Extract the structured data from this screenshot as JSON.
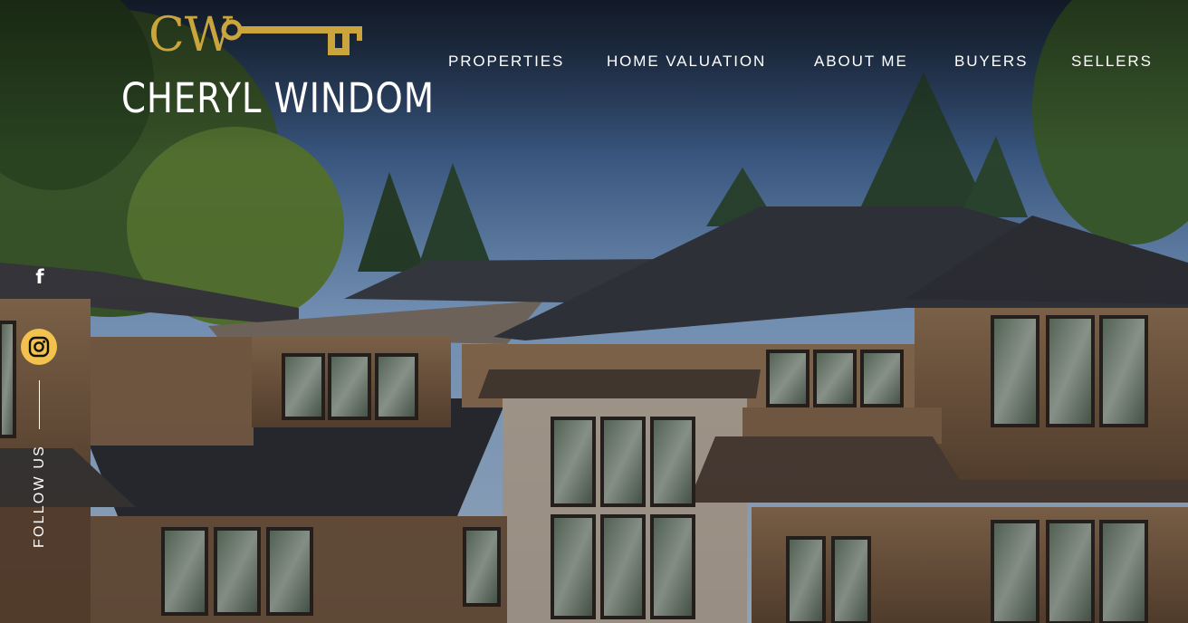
{
  "brand": {
    "monogram": "CW",
    "name": "CHERYL WINDOM",
    "accent_color": "#c9a53c"
  },
  "nav": {
    "items": [
      "PROPERTIES",
      "HOME VALUATION",
      "ABOUT ME",
      "BUYERS",
      "SELLERS"
    ]
  },
  "social": {
    "facebook_icon": "facebook-icon",
    "instagram_icon": "instagram-icon",
    "instagram_bg": "#f2c14e",
    "follow_label": "FOLLOW US"
  },
  "hero": {
    "image": "house-exterior-photo"
  }
}
